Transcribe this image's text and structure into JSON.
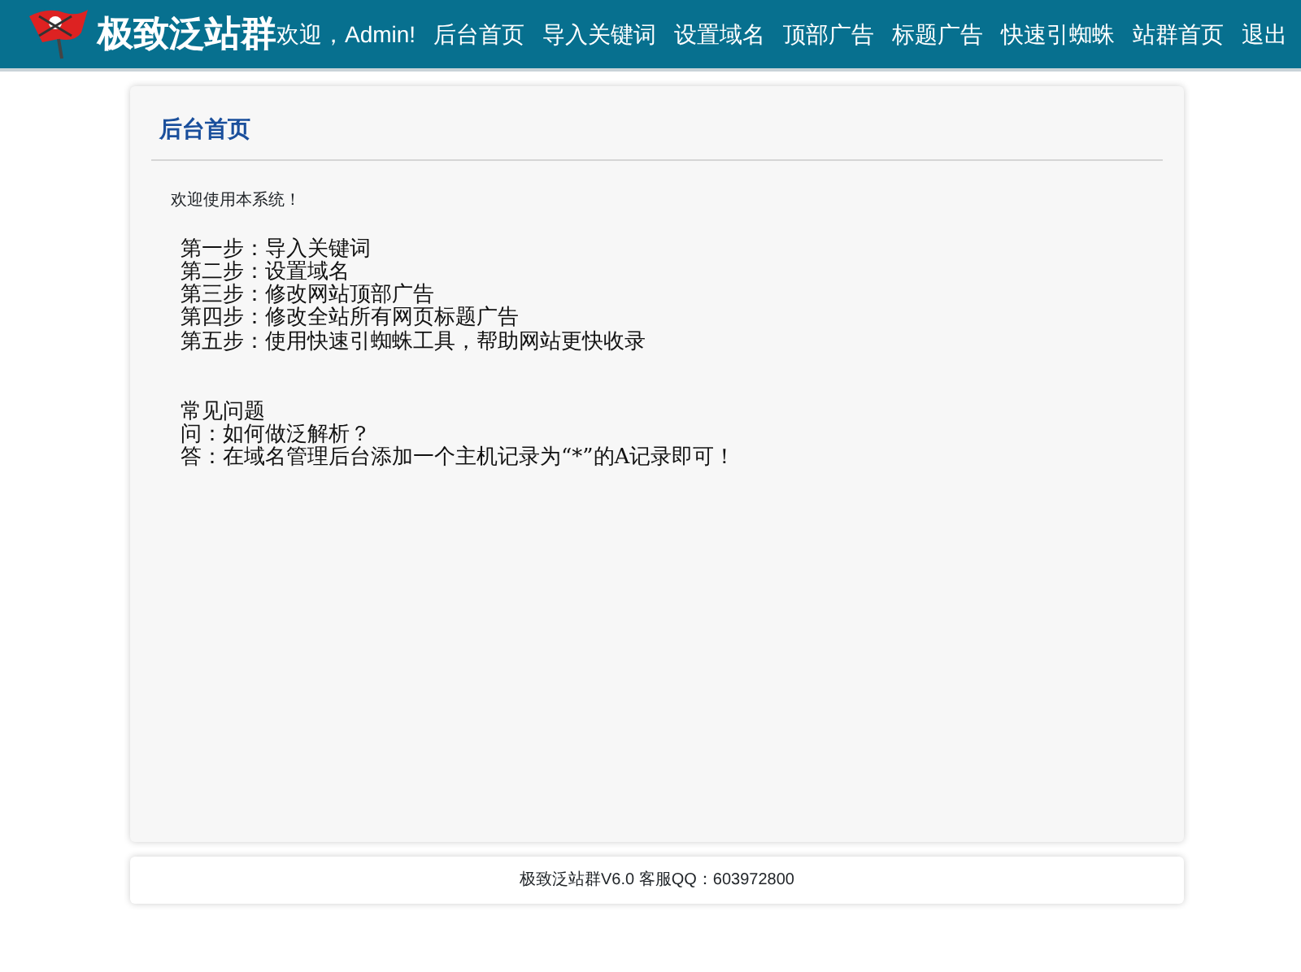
{
  "brand": "极致泛站群",
  "greeting": "欢迎，Admin!",
  "nav": [
    "后台首页",
    "导入关键词",
    "设置域名",
    "顶部广告",
    "标题广告",
    "快速引蜘蛛",
    "站群首页",
    "退出"
  ],
  "panel": {
    "title": "后台首页",
    "welcome": "欢迎使用本系统！",
    "steps": [
      "第一步：导入关键词",
      "第二步：设置域名",
      "第三步：修改网站顶部广告",
      "第四步：修改全站所有网页标题广告",
      "第五步：使用快速引蜘蛛工具，帮助网站更快收录"
    ],
    "faq_title": "常见问题",
    "faq": [
      "问：如何做泛解析？",
      "答：在域名管理后台添加一个主机记录为“*”的A记录即可！"
    ]
  },
  "footer": "极致泛站群V6.0 客服QQ：603972800"
}
